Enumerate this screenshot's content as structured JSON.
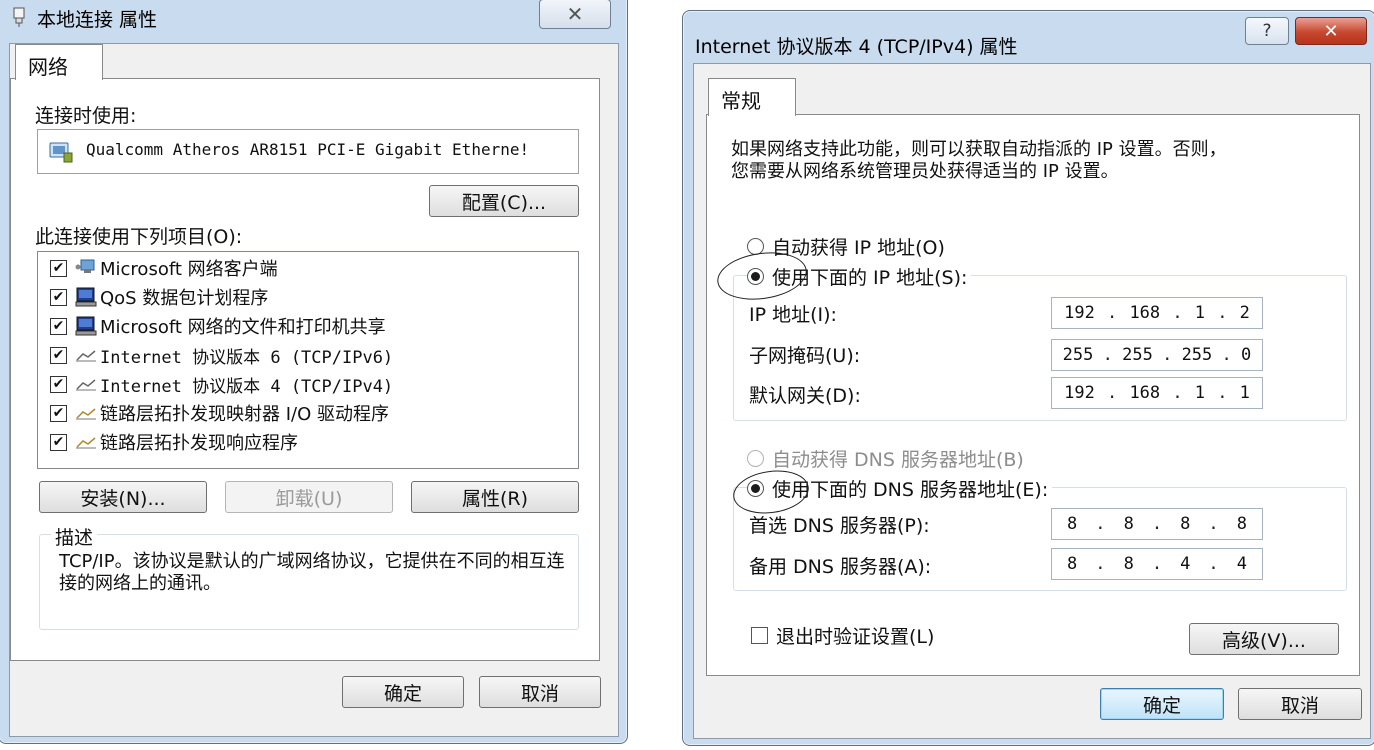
{
  "left_dialog": {
    "title": "本地连接 属性",
    "close_glyph": "✕",
    "tab": "网络",
    "connect_using_label": "连接时使用:",
    "adapter_name": "Qualcomm Atheros AR8151 PCI-E Gigabit Etherne!",
    "configure_button": "配置(C)...",
    "items_label": "此连接使用下列项目(O):",
    "items": [
      {
        "label": "Microsoft 网络客户端",
        "checked": true,
        "icon": "network-client-icon"
      },
      {
        "label": "QoS 数据包计划程序",
        "checked": true,
        "icon": "qos-scheduler-icon"
      },
      {
        "label": "Microsoft 网络的文件和打印机共享",
        "checked": true,
        "icon": "file-printer-sharing-icon"
      },
      {
        "label": "Internet 协议版本 6 (TCP/IPv6)",
        "checked": true,
        "icon": "protocol-icon"
      },
      {
        "label": "Internet 协议版本 4 (TCP/IPv4)",
        "checked": true,
        "icon": "protocol-icon"
      },
      {
        "label": "链路层拓扑发现映射器 I/O 驱动程序",
        "checked": true,
        "icon": "protocol-icon"
      },
      {
        "label": "链路层拓扑发现响应程序",
        "checked": true,
        "icon": "protocol-icon"
      }
    ],
    "install_button": "安装(N)...",
    "uninstall_button": "卸载(U)",
    "properties_button": "属性(R)",
    "description_title": "描述",
    "description_text": "TCP/IP。该协议是默认的广域网络协议，它提供在不同的相互连接的网络上的通讯。",
    "ok_button": "确定",
    "cancel_button": "取消"
  },
  "right_dialog": {
    "title": "Internet 协议版本 4 (TCP/IPv4) 属性",
    "help_glyph": "?",
    "close_glyph": "✕",
    "tab": "常规",
    "intro_line1": "如果网络支持此功能，则可以获取自动指派的 IP 设置。否则，",
    "intro_line2": "您需要从网络系统管理员处获得适当的 IP 设置。",
    "auto_ip_label": "自动获得 IP 地址(O)",
    "use_ip_label": "使用下面的 IP 地址(S):",
    "ip_address_label": "IP 地址(I):",
    "ip_address": [
      "192",
      "168",
      "1",
      "2"
    ],
    "subnet_label": "子网掩码(U):",
    "subnet": [
      "255",
      "255",
      "255",
      "0"
    ],
    "gateway_label": "默认网关(D):",
    "gateway": [
      "192",
      "168",
      "1",
      "1"
    ],
    "auto_dns_label": "自动获得 DNS 服务器地址(B)",
    "use_dns_label": "使用下面的 DNS 服务器地址(E):",
    "preferred_dns_label": "首选 DNS 服务器(P):",
    "preferred_dns": [
      "8",
      "8",
      "8",
      "8"
    ],
    "alternate_dns_label": "备用 DNS 服务器(A):",
    "alternate_dns": [
      "8",
      "8",
      "4",
      "4"
    ],
    "validate_label": "退出时验证设置(L)",
    "validate_checked": false,
    "advanced_button": "高级(V)...",
    "ok_button": "确定",
    "cancel_button": "取消"
  }
}
